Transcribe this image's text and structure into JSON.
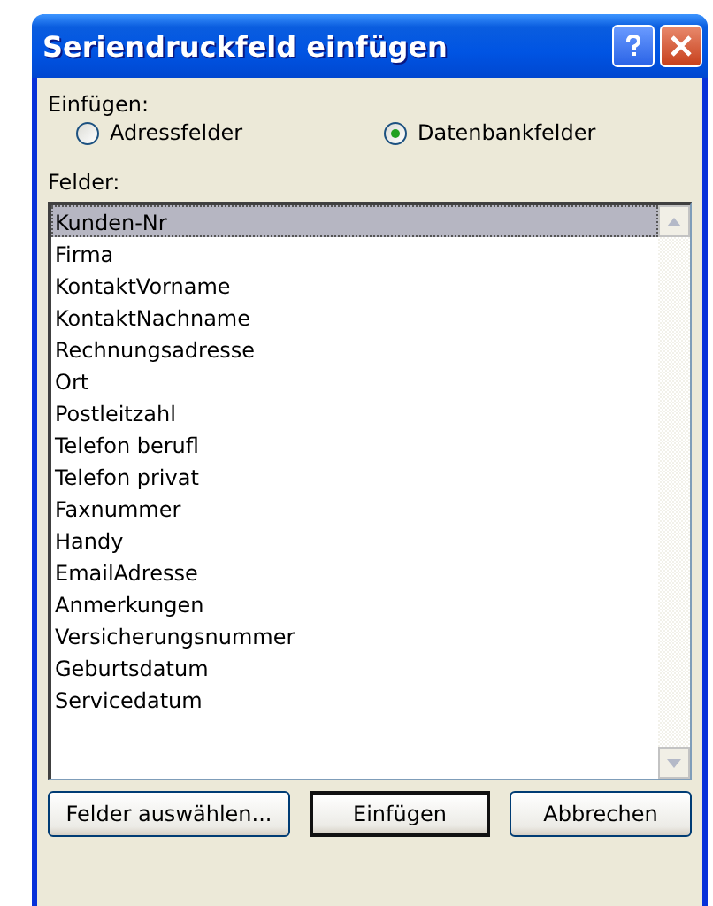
{
  "window": {
    "title": "Seriendruckfeld einfügen"
  },
  "insert_group": {
    "label": "Einfügen:",
    "options": [
      {
        "label": "Adressfelder",
        "selected": false
      },
      {
        "label": "Datenbankfelder",
        "selected": true
      }
    ]
  },
  "fields": {
    "label": "Felder:",
    "items": [
      {
        "label": "Kunden-Nr",
        "selected": true
      },
      {
        "label": "Firma",
        "selected": false
      },
      {
        "label": "KontaktVorname",
        "selected": false
      },
      {
        "label": "KontaktNachname",
        "selected": false
      },
      {
        "label": "Rechnungsadresse",
        "selected": false
      },
      {
        "label": "Ort",
        "selected": false
      },
      {
        "label": "Postleitzahl",
        "selected": false
      },
      {
        "label": "Telefon berufl",
        "selected": false
      },
      {
        "label": "Telefon privat",
        "selected": false
      },
      {
        "label": "Faxnummer",
        "selected": false
      },
      {
        "label": "Handy",
        "selected": false
      },
      {
        "label": "EmailAdresse",
        "selected": false
      },
      {
        "label": "Anmerkungen",
        "selected": false
      },
      {
        "label": "Versicherungsnummer",
        "selected": false
      },
      {
        "label": "Geburtsdatum",
        "selected": false
      },
      {
        "label": "Servicedatum",
        "selected": false
      }
    ]
  },
  "buttons": [
    {
      "label": "Felder auswählen...",
      "default": false
    },
    {
      "label": "Einfügen",
      "default": true
    },
    {
      "label": "Abbrechen",
      "default": false
    }
  ]
}
